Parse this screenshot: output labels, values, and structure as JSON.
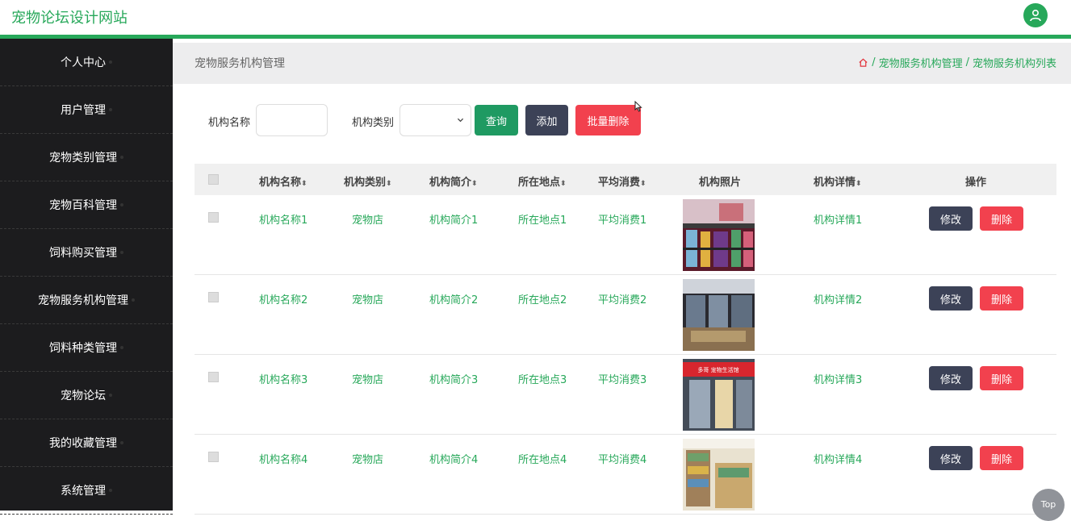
{
  "header": {
    "site_title": "宠物论坛设计网站",
    "avatar_icon": "user-icon"
  },
  "sidebar": {
    "items": [
      {
        "label": "个人中心"
      },
      {
        "label": "用户管理"
      },
      {
        "label": "宠物类别管理"
      },
      {
        "label": "宠物百科管理"
      },
      {
        "label": "饲料购买管理"
      },
      {
        "label": "宠物服务机构管理"
      },
      {
        "label": "饲料种类管理"
      },
      {
        "label": "宠物论坛"
      },
      {
        "label": "我的收藏管理"
      },
      {
        "label": "系统管理"
      }
    ]
  },
  "page": {
    "title": "宠物服务机构管理",
    "breadcrumb": {
      "home_icon": "home-icon",
      "level1": "宠物服务机构管理",
      "level2": "宠物服务机构列表",
      "separator": "/"
    }
  },
  "search": {
    "name_label": "机构名称",
    "name_value": "",
    "type_label": "机构类别",
    "type_value": "",
    "query_button": "查询",
    "add_button": "添加",
    "batch_delete_button": "批量删除"
  },
  "table": {
    "headers": {
      "name": "机构名称",
      "type": "机构类别",
      "intro": "机构简介",
      "location": "所在地点",
      "cost": "平均消费",
      "photo": "机构照片",
      "detail": "机构详情",
      "action": "操作"
    },
    "sort_glyph": "⬍",
    "rows": [
      {
        "name": "机构名称1",
        "type": "宠物店",
        "intro": "机构简介1",
        "location": "所在地点1",
        "cost": "平均消费1",
        "detail": "机构详情1",
        "edit": "修改",
        "delete": "删除"
      },
      {
        "name": "机构名称2",
        "type": "宠物店",
        "intro": "机构简介2",
        "location": "所在地点2",
        "cost": "平均消费2",
        "detail": "机构详情2",
        "edit": "修改",
        "delete": "删除"
      },
      {
        "name": "机构名称3",
        "type": "宠物店",
        "intro": "机构简介3",
        "location": "所在地点3",
        "cost": "平均消费3",
        "detail": "机构详情3",
        "edit": "修改",
        "delete": "删除",
        "photo_sign": "多哥 宠物生活馆"
      },
      {
        "name": "机构名称4",
        "type": "宠物店",
        "intro": "机构简介4",
        "location": "所在地点4",
        "cost": "平均消费4",
        "detail": "机构详情4",
        "edit": "修改",
        "delete": "删除"
      }
    ]
  },
  "misc": {
    "top_button": "Top"
  },
  "colors": {
    "accent": "#27a85a",
    "sidebar_bg": "#1c1c1e",
    "danger": "#f2414e",
    "dark_button": "#3c4257"
  }
}
